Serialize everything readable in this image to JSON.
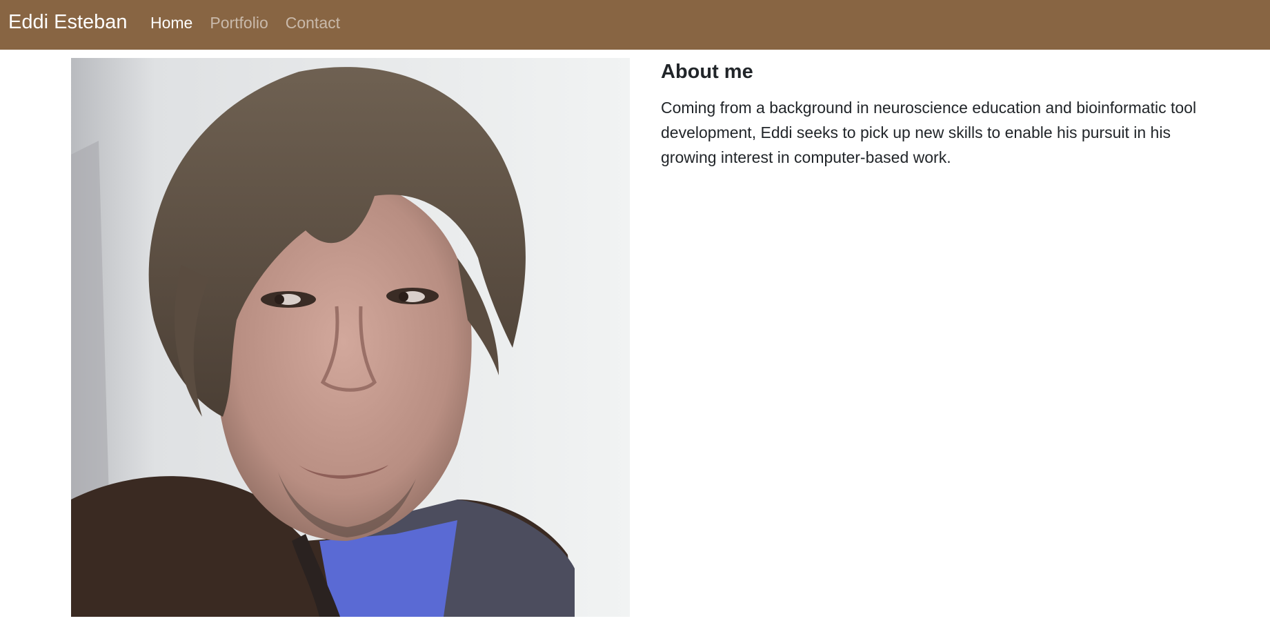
{
  "navbar": {
    "brand": "Eddi Esteban",
    "links": [
      {
        "label": "Home",
        "active": true
      },
      {
        "label": "Portfolio",
        "active": false
      },
      {
        "label": "Contact",
        "active": false
      }
    ],
    "background_color": "#886543"
  },
  "about": {
    "heading": "About me",
    "body": "Coming from a background in neuroscience education and bioinformatic tool development, Eddi seeks to pick up new skills to enable his pursuit in his growing interest in computer-based work."
  },
  "colors": {
    "nav_text_active": "#ffffff",
    "nav_text_inactive": "rgba(255,255,255,0.55)",
    "body_text": "#212529"
  }
}
